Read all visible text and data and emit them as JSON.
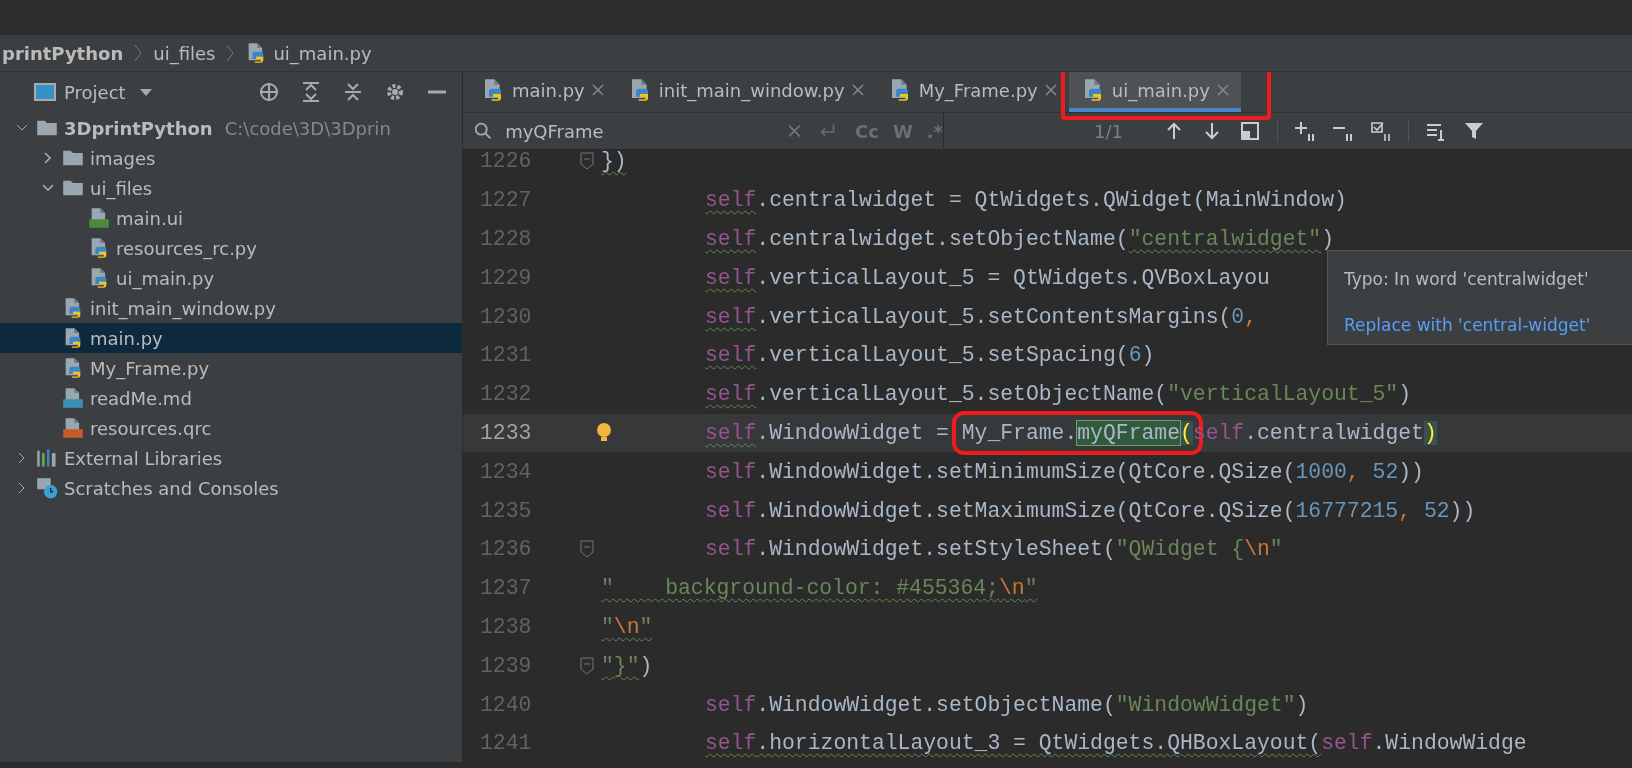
{
  "breadcrumb": [
    {
      "label": "printPython",
      "kind": "folder"
    },
    {
      "label": "ui_files",
      "kind": "folder"
    },
    {
      "label": "ui_main.py",
      "kind": "python"
    }
  ],
  "project_panel": {
    "title": "Project"
  },
  "tree": [
    {
      "label": "3DprintPython",
      "path": "C:\\code\\3D\\3Dprin",
      "kind": "folder",
      "expanded": true,
      "selected": false,
      "children": [
        {
          "label": "images",
          "kind": "folder",
          "expanded": false,
          "selected": false
        },
        {
          "label": "ui_files",
          "kind": "folder",
          "expanded": true,
          "selected": false,
          "children": [
            {
              "label": "main.ui",
              "kind": "qt",
              "selected": false
            },
            {
              "label": "resources_rc.py",
              "kind": "python",
              "selected": false
            },
            {
              "label": "ui_main.py",
              "kind": "python",
              "selected": false
            }
          ]
        },
        {
          "label": "init_main_window.py",
          "kind": "python",
          "selected": false
        },
        {
          "label": "main.py",
          "kind": "python",
          "selected": true
        },
        {
          "label": "My_Frame.py",
          "kind": "python",
          "selected": false
        },
        {
          "label": "readMe.md",
          "kind": "markdown",
          "selected": false
        },
        {
          "label": "resources.qrc",
          "kind": "qrc",
          "selected": false
        }
      ]
    },
    {
      "label": "External Libraries",
      "kind": "libraries",
      "expanded": false,
      "selected": false
    },
    {
      "label": "Scratches and Consoles",
      "kind": "scratches",
      "expanded": false,
      "selected": false
    }
  ],
  "tabs": [
    {
      "label": "main.py",
      "selected": false,
      "annotated": false
    },
    {
      "label": "init_main_window.py",
      "selected": false,
      "annotated": false
    },
    {
      "label": "My_Frame.py",
      "selected": false,
      "annotated": false
    },
    {
      "label": "ui_main.py",
      "selected": true,
      "annotated": true
    }
  ],
  "search": {
    "value": "myQFrame",
    "options": [
      "Cc",
      "W",
      ".*"
    ],
    "count": "1/1"
  },
  "code": [
    {
      "number": "1226",
      "indented": false,
      "fold": true,
      "current": false,
      "bulb": false,
      "tokens": [
        {
          "kind": "plain",
          "text": "})",
          "typo": true
        }
      ]
    },
    {
      "number": "1227",
      "indented": true,
      "fold": false,
      "current": false,
      "bulb": false,
      "tokens": [
        {
          "kind": "self",
          "text": "self",
          "typo": true
        },
        {
          "kind": "plain",
          "text": ".centralwidget = QtWidgets.QWidget(MainWindow)",
          "typo": false
        }
      ]
    },
    {
      "number": "1228",
      "indented": true,
      "fold": false,
      "current": false,
      "bulb": false,
      "tokens": [
        {
          "kind": "self",
          "text": "self",
          "typo": true
        },
        {
          "kind": "plain",
          "text": ".centralwidget.setObjectName(",
          "typo": false
        },
        {
          "kind": "string",
          "text": "\"centralwidget\"",
          "typo": true
        },
        {
          "kind": "plain",
          "text": ")",
          "typo": false
        }
      ]
    },
    {
      "number": "1229",
      "indented": true,
      "fold": false,
      "current": false,
      "bulb": false,
      "tokens": [
        {
          "kind": "self",
          "text": "self",
          "typo": true
        },
        {
          "kind": "plain",
          "text": ".verticalLayout_5 = QtWidgets.QVBoxLayou",
          "typo": false
        }
      ]
    },
    {
      "number": "1230",
      "indented": true,
      "fold": false,
      "current": false,
      "bulb": false,
      "tokens": [
        {
          "kind": "self",
          "text": "self",
          "typo": true
        },
        {
          "kind": "plain",
          "text": ".verticalLayout_5.setContentsMargins(",
          "typo": false
        },
        {
          "kind": "number",
          "text": "0",
          "typo": false
        },
        {
          "kind": "punct",
          "text": ",",
          "typo": false
        }
      ]
    },
    {
      "number": "1231",
      "indented": true,
      "fold": false,
      "current": false,
      "bulb": false,
      "tokens": [
        {
          "kind": "self",
          "text": "self",
          "typo": true
        },
        {
          "kind": "plain",
          "text": ".verticalLayout_5.setSpacing(",
          "typo": false
        },
        {
          "kind": "number",
          "text": "6",
          "typo": false
        },
        {
          "kind": "plain",
          "text": ")",
          "typo": false
        }
      ]
    },
    {
      "number": "1232",
      "indented": true,
      "fold": false,
      "current": false,
      "bulb": false,
      "tokens": [
        {
          "kind": "self",
          "text": "self",
          "typo": true
        },
        {
          "kind": "plain",
          "text": ".verticalLayout_5.setObjectName(",
          "typo": false
        },
        {
          "kind": "string",
          "text": "\"verticalLayout_5\"",
          "typo": false
        },
        {
          "kind": "plain",
          "text": ")",
          "typo": false
        }
      ]
    },
    {
      "number": "1233",
      "indented": true,
      "fold": false,
      "current": true,
      "bulb": true,
      "tokens": [
        {
          "kind": "self",
          "text": "self",
          "typo": true
        },
        {
          "kind": "plain",
          "text": ".WindowWidget = ",
          "typo": false
        },
        {
          "kind": "plain",
          "text": "My_Frame.",
          "typo": false,
          "annotated": true
        },
        {
          "kind": "match",
          "text": "myQFrame",
          "typo": false,
          "annotated": true
        },
        {
          "kind": "brace",
          "text": "(",
          "typo": false,
          "annotated": true
        },
        {
          "kind": "self",
          "text": "self",
          "typo": false
        },
        {
          "kind": "plain",
          "text": ".centralwidget",
          "typo": false
        },
        {
          "kind": "brace",
          "text": ")",
          "typo": false
        }
      ]
    },
    {
      "number": "1234",
      "indented": true,
      "fold": false,
      "current": false,
      "bulb": false,
      "tokens": [
        {
          "kind": "self",
          "text": "self",
          "typo": false
        },
        {
          "kind": "plain",
          "text": ".WindowWidget.setMinimumSize(QtCore.QSize(",
          "typo": false
        },
        {
          "kind": "number",
          "text": "1000",
          "typo": false
        },
        {
          "kind": "punct",
          "text": ", ",
          "typo": false
        },
        {
          "kind": "number",
          "text": "52",
          "typo": false
        },
        {
          "kind": "plain",
          "text": "))",
          "typo": false
        }
      ]
    },
    {
      "number": "1235",
      "indented": true,
      "fold": false,
      "current": false,
      "bulb": false,
      "tokens": [
        {
          "kind": "self",
          "text": "self",
          "typo": false
        },
        {
          "kind": "plain",
          "text": ".WindowWidget.setMaximumSize(QtCore.QSize(",
          "typo": false
        },
        {
          "kind": "number",
          "text": "16777215",
          "typo": false
        },
        {
          "kind": "punct",
          "text": ", ",
          "typo": false
        },
        {
          "kind": "number",
          "text": "52",
          "typo": false
        },
        {
          "kind": "plain",
          "text": "))",
          "typo": false
        }
      ]
    },
    {
      "number": "1236",
      "indented": true,
      "fold": true,
      "current": false,
      "bulb": false,
      "tokens": [
        {
          "kind": "self",
          "text": "self",
          "typo": false
        },
        {
          "kind": "plain",
          "text": ".WindowWidget.setStyleSheet(",
          "typo": false
        },
        {
          "kind": "string",
          "text": "\"QWidget {",
          "typo": false
        },
        {
          "kind": "escape",
          "text": "\\n",
          "typo": false
        },
        {
          "kind": "string",
          "text": "\"",
          "typo": false
        }
      ]
    },
    {
      "number": "1237",
      "indented": false,
      "fold": false,
      "current": false,
      "bulb": false,
      "tokens": [
        {
          "kind": "string",
          "text": "\"    background-color: #455364;",
          "typo": true
        },
        {
          "kind": "escape",
          "text": "\\n",
          "typo": true
        },
        {
          "kind": "string",
          "text": "\"",
          "typo": true
        }
      ]
    },
    {
      "number": "1238",
      "indented": false,
      "fold": false,
      "current": false,
      "bulb": false,
      "tokens": [
        {
          "kind": "string",
          "text": "\"",
          "typo": true
        },
        {
          "kind": "escape",
          "text": "\\n",
          "typo": true
        },
        {
          "kind": "string",
          "text": "\"",
          "typo": true
        }
      ]
    },
    {
      "number": "1239",
      "indented": false,
      "fold": true,
      "current": false,
      "bulb": false,
      "tokens": [
        {
          "kind": "string",
          "text": "\"}\"",
          "typo": true
        },
        {
          "kind": "plain",
          "text": ")",
          "typo": false
        }
      ]
    },
    {
      "number": "1240",
      "indented": true,
      "fold": false,
      "current": false,
      "bulb": false,
      "tokens": [
        {
          "kind": "self",
          "text": "self",
          "typo": false
        },
        {
          "kind": "plain",
          "text": ".WindowWidget.setObjectName(",
          "typo": false
        },
        {
          "kind": "string",
          "text": "\"WindowWidget\"",
          "typo": false
        },
        {
          "kind": "plain",
          "text": ")",
          "typo": false
        }
      ]
    },
    {
      "number": "1241",
      "indented": true,
      "fold": false,
      "current": false,
      "bulb": false,
      "tokens": [
        {
          "kind": "self",
          "text": "self",
          "typo": true
        },
        {
          "kind": "plain",
          "text": ".horizontalLayout_3 = QtWidgets.QHBoxLayout(",
          "typo": true
        },
        {
          "kind": "self",
          "text": "self",
          "typo": false
        },
        {
          "kind": "plain",
          "text": ".WindowWidge",
          "typo": false
        }
      ]
    }
  ],
  "tooltip": {
    "title": "Typo: In word 'centralwidget'",
    "action": "Replace with 'central-widget'"
  }
}
